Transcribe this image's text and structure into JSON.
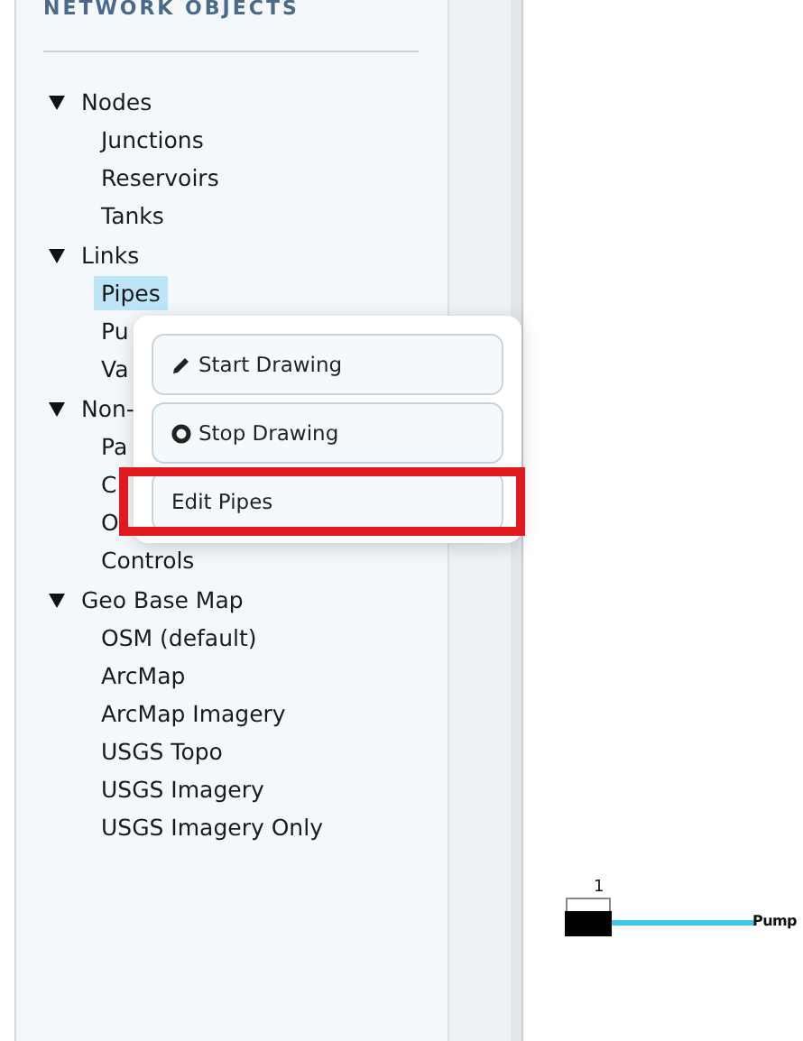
{
  "sidebar": {
    "title": "NETWORK OBJECTS",
    "tree": [
      {
        "label": "Nodes",
        "expanded": true,
        "children": [
          {
            "label": "Junctions",
            "selected": false
          },
          {
            "label": "Reservoirs",
            "selected": false
          },
          {
            "label": "Tanks",
            "selected": false
          }
        ]
      },
      {
        "label": "Links",
        "expanded": true,
        "children": [
          {
            "label": "Pipes",
            "selected": true
          },
          {
            "label": "Pu",
            "selected": false
          },
          {
            "label": "Va",
            "selected": false
          }
        ]
      },
      {
        "label": "Non-",
        "expanded": true,
        "children": [
          {
            "label": "Pa",
            "selected": false
          },
          {
            "label": "C",
            "selected": false
          },
          {
            "label": "O",
            "selected": false
          },
          {
            "label": "Controls",
            "selected": false
          }
        ]
      },
      {
        "label": "Geo Base Map",
        "expanded": true,
        "children": [
          {
            "label": "OSM (default)",
            "selected": false
          },
          {
            "label": "ArcMap",
            "selected": false
          },
          {
            "label": "ArcMap Imagery",
            "selected": false
          },
          {
            "label": "USGS Topo",
            "selected": false
          },
          {
            "label": "USGS Imagery",
            "selected": false
          },
          {
            "label": "USGS Imagery Only",
            "selected": false
          }
        ]
      }
    ]
  },
  "context_menu": {
    "buttons": [
      {
        "label": "Start Drawing",
        "highlighted": false
      },
      {
        "label": "Stop Drawing",
        "highlighted": false
      },
      {
        "label": "Edit Pipes",
        "highlighted": true
      }
    ]
  },
  "canvas": {
    "node_label": "1",
    "link_label": "Pump"
  }
}
